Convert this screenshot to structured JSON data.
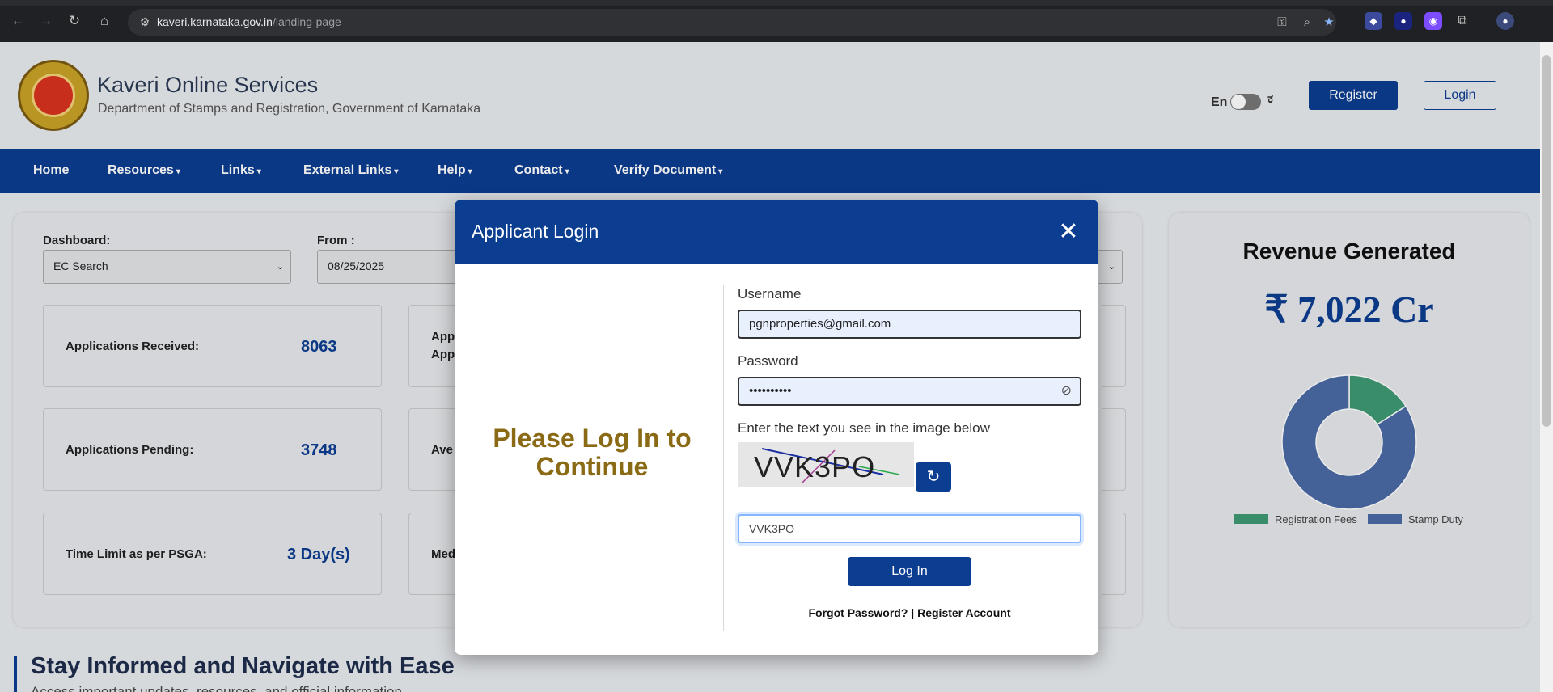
{
  "browser": {
    "url_host": "kaveri.karnataka.gov.in",
    "url_path": "/landing-page",
    "icons": [
      "back-icon",
      "forward-icon",
      "reload-icon",
      "home-icon",
      "site-settings-icon",
      "password-key-icon",
      "zoom-icon",
      "bookmark-star-icon",
      "extension-icon",
      "profile-icon"
    ]
  },
  "header": {
    "title": "Kaveri Online Services",
    "subtitle": "Department of Stamps and Registration, Government of Karnataka",
    "lang_en": "En",
    "lang_kn": "ಕ",
    "register_label": "Register",
    "login_label": "Login"
  },
  "nav": {
    "items": [
      {
        "label": "Home",
        "has_menu": false
      },
      {
        "label": "Resources",
        "has_menu": true
      },
      {
        "label": "Links",
        "has_menu": true
      },
      {
        "label": "External Links",
        "has_menu": true
      },
      {
        "label": "Help",
        "has_menu": true
      },
      {
        "label": "Contact",
        "has_menu": true
      },
      {
        "label": "Verify Document",
        "has_menu": true
      }
    ],
    "caret": "▾"
  },
  "dashboard": {
    "dashboard_label": "Dashboard:",
    "dashboard_value": "EC Search",
    "from_label": "From :",
    "from_value": "08/25/2025",
    "stats": [
      {
        "label": "Applications Received:",
        "value": "8063"
      },
      {
        "label": "Applications Pending:",
        "value": "3748"
      },
      {
        "label": "Time Limit as per PSGA:",
        "value": "3 Day(s)"
      }
    ],
    "partial_labels": [
      "App",
      "App",
      "Ave",
      "Med"
    ]
  },
  "revenue": {
    "title": "Revenue Generated",
    "value": "₹ 7,022 Cr",
    "legend": [
      {
        "label": "Registration Fees",
        "color": "#3e9a73"
      },
      {
        "label": "Stamp Duty",
        "color": "#4a6aa5"
      }
    ]
  },
  "chart_data": {
    "type": "pie",
    "title": "",
    "categories": [
      "Registration Fees",
      "Stamp Duty"
    ],
    "values": [
      16,
      84
    ],
    "colors": [
      "#3e9a73",
      "#4a6aa5"
    ],
    "legend_position": "bottom"
  },
  "bottom": {
    "title": "Stay Informed and Navigate with Ease",
    "subtitle": "Access important updates, resources, and official information"
  },
  "modal": {
    "title": "Applicant Login",
    "close_glyph": "✕",
    "left_message": "Please Log In to Continue",
    "username_label": "Username",
    "username_value": "pgnproperties@gmail.com",
    "password_label": "Password",
    "password_value": "••••••••••",
    "captcha_prompt": "Enter the text you see in the image below",
    "captcha_image_text": "VVK3PO",
    "captcha_input_value": "VVK3PO",
    "login_button": "Log In",
    "forgot_password": "Forgot Password?",
    "separator": " | ",
    "register_account": "Register Account"
  }
}
